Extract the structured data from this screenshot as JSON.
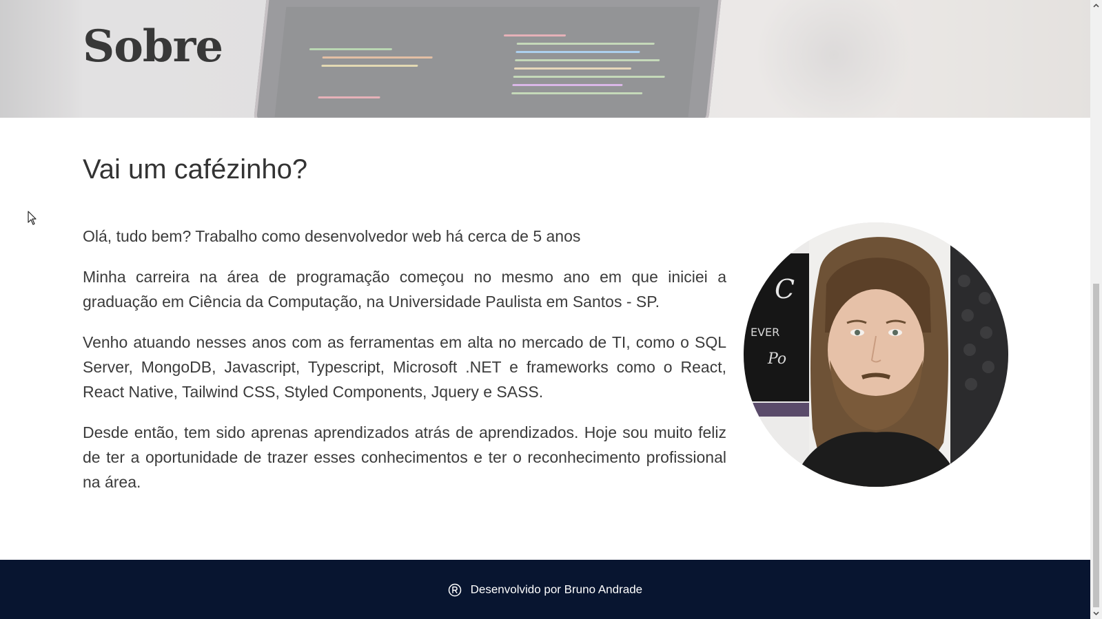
{
  "hero": {
    "title": "Sobre"
  },
  "about": {
    "heading": "Vai um cafézinho?",
    "paragraphs": [
      "Olá, tudo bem? Trabalho como desenvolvedor web há cerca de 5 anos",
      "Minha carreira na área de programação começou no mesmo ano em que iniciei a graduação em Ciência da Computação, na Universidade Paulista em Santos - SP.",
      "Venho atuando nesses anos com as ferramentas em alta no mercado de TI, como o SQL Server, MongoDB, Javascript, Typescript, Microsoft .NET e frameworks como o React, React Native, Tailwind CSS, Styled Components, Jquery e SASS.",
      "Desde então, tem sido aprenas aprendizados atrás de aprendizados. Hoje sou muito feliz de ter a oportunidade de trazer esses conhecimentos e ter o reconhecimento profissional na área."
    ]
  },
  "footer": {
    "icon": "registered-icon",
    "text": "Desenvolvido por Bruno Andrade"
  },
  "colors": {
    "footer_bg": "#081530",
    "text": "#3b3b3b"
  }
}
